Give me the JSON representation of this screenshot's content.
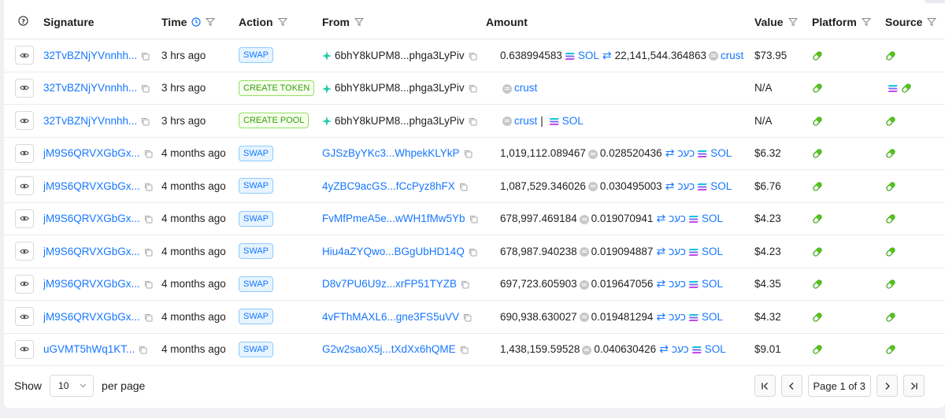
{
  "headers": {
    "signature": "Signature",
    "time": "Time",
    "action": "Action",
    "from": "From",
    "amount": "Amount",
    "value": "Value",
    "platform": "Platform",
    "source": "Source"
  },
  "rows": [
    {
      "signature": "32TvBZNjYVnnhh...",
      "time": "3 hrs ago",
      "action": "SWAP",
      "action_type": "blue",
      "from": "6bhY8kUPM8...phga3LyPiv",
      "from_kind": "wallet",
      "amount": {
        "kind": "swap",
        "a": "0.638994583",
        "a_token": "SOL",
        "a_icon": "sol",
        "b": "22,141,544.364863",
        "b_token": "crust",
        "b_icon": "coin"
      },
      "value": "$73.95",
      "source": "pill"
    },
    {
      "signature": "32TvBZNjYVnnhh...",
      "time": "3 hrs ago",
      "action": "CREATE TOKEN",
      "action_type": "green",
      "from": "6bhY8kUPM8...phga3LyPiv",
      "from_kind": "wallet",
      "amount": {
        "kind": "single",
        "a_token": "crust",
        "a_icon": "coin"
      },
      "value": "N/A",
      "source": "sol-pill"
    },
    {
      "signature": "32TvBZNjYVnnhh...",
      "time": "3 hrs ago",
      "action": "CREATE POOL",
      "action_type": "green",
      "from": "6bhY8kUPM8...phga3LyPiv",
      "from_kind": "wallet",
      "amount": {
        "kind": "pair",
        "a_token": "crust",
        "a_icon": "coin",
        "sep": "|",
        "b_token": "SOL",
        "b_icon": "sol"
      },
      "value": "N/A",
      "source": "pill"
    },
    {
      "signature": "jM9S6QRVXGbGx...",
      "time": "4 months ago",
      "action": "SWAP",
      "action_type": "blue",
      "from": "GJSzByYKc3...WhpekKLYkP",
      "from_kind": "link",
      "amount": {
        "kind": "swap",
        "a": "1,019,112.089467",
        "a_token": "כעכ",
        "a_icon": "coin",
        "b": "0.028520436",
        "b_token": "SOL",
        "b_icon": "sol"
      },
      "value": "$6.32",
      "source": "pill"
    },
    {
      "signature": "jM9S6QRVXGbGx...",
      "time": "4 months ago",
      "action": "SWAP",
      "action_type": "blue",
      "from": "4yZBC9acGS...fCcPyz8hFX",
      "from_kind": "link",
      "amount": {
        "kind": "swap",
        "a": "1,087,529.346026",
        "a_token": "כעכ",
        "a_icon": "coin",
        "b": "0.030495003",
        "b_token": "SOL",
        "b_icon": "sol"
      },
      "value": "$6.76",
      "source": "pill"
    },
    {
      "signature": "jM9S6QRVXGbGx...",
      "time": "4 months ago",
      "action": "SWAP",
      "action_type": "blue",
      "from": "FvMfPmeA5e...wWH1fMw5Yb",
      "from_kind": "link",
      "amount": {
        "kind": "swap",
        "a": "678,997.469184",
        "a_token": "כעכ",
        "a_icon": "coin",
        "b": "0.019070941",
        "b_token": "SOL",
        "b_icon": "sol"
      },
      "value": "$4.23",
      "source": "pill"
    },
    {
      "signature": "jM9S6QRVXGbGx...",
      "time": "4 months ago",
      "action": "SWAP",
      "action_type": "blue",
      "from": "Hiu4aZYQwo...BGgUbHD14Q",
      "from_kind": "link",
      "amount": {
        "kind": "swap",
        "a": "678,987.940238",
        "a_token": "כעכ",
        "a_icon": "coin",
        "b": "0.019094887",
        "b_token": "SOL",
        "b_icon": "sol"
      },
      "value": "$4.23",
      "source": "pill"
    },
    {
      "signature": "jM9S6QRVXGbGx...",
      "time": "4 months ago",
      "action": "SWAP",
      "action_type": "blue",
      "from": "D8v7PU6U9z...xrFP51TYZB",
      "from_kind": "link",
      "amount": {
        "kind": "swap",
        "a": "697,723.605903",
        "a_token": "כעכ",
        "a_icon": "coin",
        "b": "0.019647056",
        "b_token": "SOL",
        "b_icon": "sol"
      },
      "value": "$4.35",
      "source": "pill"
    },
    {
      "signature": "jM9S6QRVXGbGx...",
      "time": "4 months ago",
      "action": "SWAP",
      "action_type": "blue",
      "from": "4vFThMAXL6...gne3FS5uVV",
      "from_kind": "link",
      "amount": {
        "kind": "swap",
        "a": "690,938.630027",
        "a_token": "כעכ",
        "a_icon": "coin",
        "b": "0.019481294",
        "b_token": "SOL",
        "b_icon": "sol"
      },
      "value": "$4.32",
      "source": "pill"
    },
    {
      "signature": "uGVMT5hWq1KT...",
      "time": "4 months ago",
      "action": "SWAP",
      "action_type": "blue",
      "from": "G2w2saoX5j...tXdXx6hQME",
      "from_kind": "link",
      "amount": {
        "kind": "swap",
        "a": "1,438,159.59528",
        "a_token": "כעכ",
        "a_icon": "coin",
        "b": "0.040630426",
        "b_token": "SOL",
        "b_icon": "sol"
      },
      "value": "$9.01",
      "source": "pill"
    }
  ],
  "footer": {
    "show_label": "Show",
    "page_size": "10",
    "per_page_label": "per page",
    "page_label": "Page 1 of 3"
  },
  "colors": {
    "link": "#1677ff",
    "tag_blue": "#1677ff",
    "tag_green": "#389e0d",
    "pill_green": "#52c41a",
    "wallet_teal": "#1fc9a8"
  },
  "icons": {
    "eye": "eye-icon",
    "copy": "copy-icon",
    "filter": "filter-icon",
    "clock": "clock-icon",
    "info": "info-icon",
    "swap": "swap-arrows-icon",
    "sol": "solana-icon",
    "coin": "token-coin-icon",
    "pill": "platform-pill-icon",
    "wallet": "sparkle-wallet-icon"
  }
}
